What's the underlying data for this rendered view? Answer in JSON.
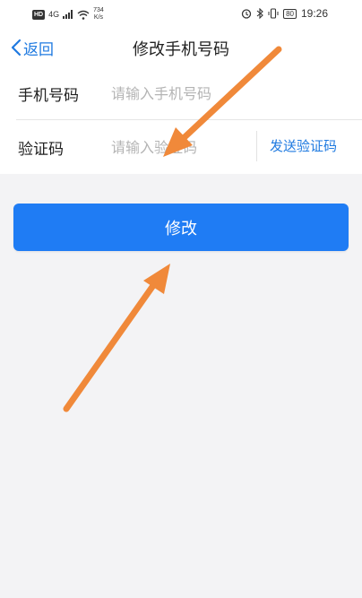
{
  "status_bar": {
    "hd": "HD",
    "signal": "4G",
    "net_speed_value": "734",
    "net_speed_unit": "K/s",
    "battery": "80",
    "time": "19:26"
  },
  "nav": {
    "back_label": "返回",
    "title": "修改手机号码"
  },
  "form": {
    "phone": {
      "label": "手机号码",
      "placeholder": "请输入手机号码",
      "value": ""
    },
    "code": {
      "label": "验证码",
      "placeholder": "请输入验证码",
      "value": "",
      "send_label": "发送验证码"
    }
  },
  "submit_label": "修改",
  "colors": {
    "accent": "#1f7cf4",
    "link": "#1f7ae0",
    "background": "#f3f3f5",
    "annotation_arrow": "#f0893a"
  }
}
